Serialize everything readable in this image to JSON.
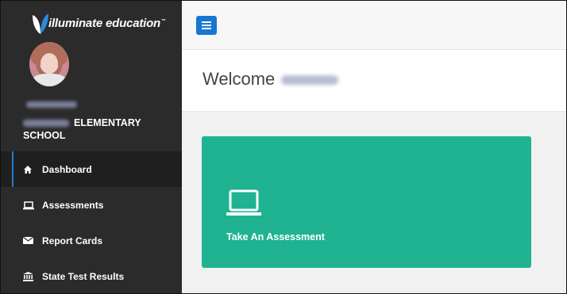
{
  "brand": {
    "name": "illuminate education",
    "trademark": "™"
  },
  "school": {
    "name_suffix": "ELEMENTARY SCHOOL"
  },
  "nav": {
    "items": [
      {
        "label": "Dashboard",
        "icon": "home-icon",
        "active": true
      },
      {
        "label": "Assessments",
        "icon": "laptop-icon",
        "active": false
      },
      {
        "label": "Report Cards",
        "icon": "envelope-icon",
        "active": false
      },
      {
        "label": "State Test Results",
        "icon": "institution-icon",
        "active": false
      }
    ]
  },
  "header": {
    "welcome": "Welcome"
  },
  "tiles": [
    {
      "label": "Take An Assessment",
      "icon": "laptop-icon"
    }
  ],
  "colors": {
    "sidebar": "#2b2b2b",
    "sidebar_active": "#1f1f1f",
    "accent": "#1877d2",
    "tile": "#1fb391"
  }
}
